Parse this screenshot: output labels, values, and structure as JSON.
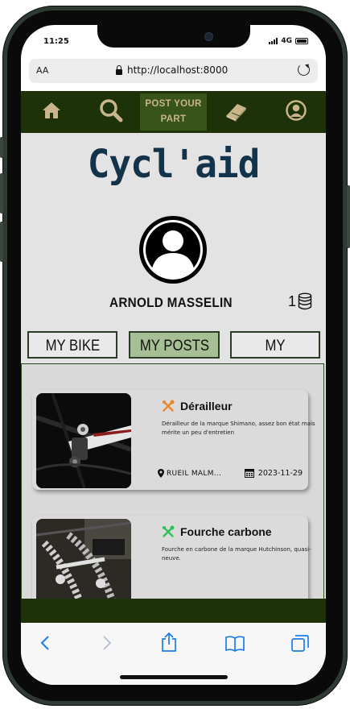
{
  "status_bar": {
    "time": "11:25",
    "network": "4G"
  },
  "browser": {
    "text_size_label": "AA",
    "url": "http://localhost:8000"
  },
  "navbar": {
    "post_label_line1": "POST YOUR",
    "post_label_line2": "PART",
    "accent_color": "#c9b58a",
    "background_color": "#1d3209",
    "icons": [
      "home-icon",
      "search-icon",
      "book-icon",
      "user-icon"
    ]
  },
  "app": {
    "title": "Cycl'aid",
    "title_color": "#13334b"
  },
  "profile": {
    "name": "ARNOLD MASSELIN",
    "coins": "1"
  },
  "tabs": [
    {
      "label": "MY BIKE",
      "active": false
    },
    {
      "label": "MY POSTS",
      "active": true
    },
    {
      "label": "MY WISHES",
      "active": false
    }
  ],
  "posts": [
    {
      "title": "Dérailleur",
      "icon_color": "#e8882a",
      "description": "Dérailleur de la marque Shimano, assez bon état mais mérite un peu d'entretien",
      "location": "RUEIL MALM...",
      "date": "2023-11-29"
    },
    {
      "title": "Fourche carbone",
      "icon_color": "#2fc05c",
      "description": "Fourche en carbone de la marque Hutchinson, quasi-neuve.",
      "location": "",
      "date": ""
    }
  ],
  "safari_toolbar": {
    "icons": [
      "back-icon",
      "forward-icon",
      "share-icon",
      "bookmarks-icon",
      "tabs-icon"
    ]
  }
}
